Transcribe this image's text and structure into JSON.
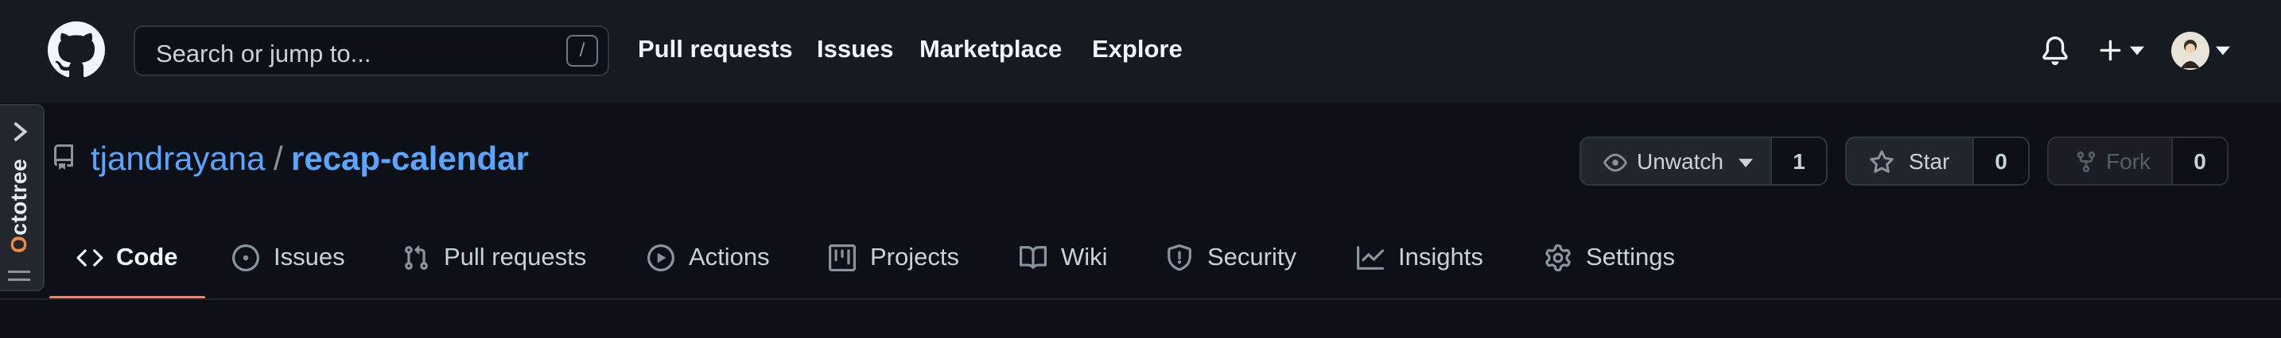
{
  "header": {
    "search_placeholder": "Search or jump to...",
    "search_shortcut": "/",
    "nav": [
      "Pull requests",
      "Issues",
      "Marketplace",
      "Explore"
    ]
  },
  "octotree": {
    "label_first": "O",
    "label_rest": "ctotree"
  },
  "repo": {
    "owner": "tjandrayana",
    "separator": "/",
    "name": "recap-calendar"
  },
  "actions": {
    "watch_label": "Unwatch",
    "watch_count": "1",
    "star_label": "Star",
    "star_count": "0",
    "fork_label": "Fork",
    "fork_count": "0"
  },
  "tabs": [
    "Code",
    "Issues",
    "Pull requests",
    "Actions",
    "Projects",
    "Wiki",
    "Security",
    "Insights",
    "Settings"
  ],
  "colors": {
    "header_bg": "#161b22",
    "page_bg": "#0d1117",
    "link": "#58a6ff",
    "active_tab_underline": "#f78166"
  }
}
